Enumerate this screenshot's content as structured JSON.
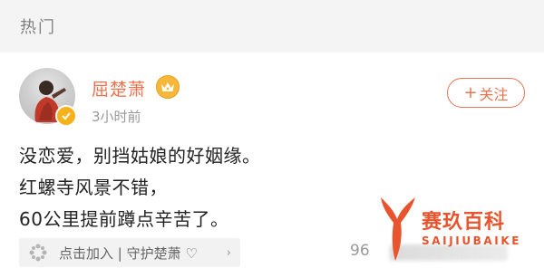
{
  "section": {
    "title": "热门"
  },
  "user": {
    "name": "屈楚萧",
    "time": "3小时前",
    "avatar_icon": "user-avatar",
    "verified_icon": "verified-badge-icon",
    "crown_icon": "crown-icon"
  },
  "follow": {
    "plus": "+",
    "label": "关注"
  },
  "post": {
    "lines": [
      "没恋爱，别挡姑娘的好姻缘。",
      "红螺寺风景不错，",
      "60公里提前蹲点辛苦了。"
    ]
  },
  "fan_club": {
    "label": "点击加入 | 守护楚萧 ♡",
    "icon": "fan-club-icon",
    "chevron": "›"
  },
  "stats": {
    "count_visible": "96"
  },
  "watermark": {
    "name": "赛玖百科",
    "sub": "SAIJIUBAIKE"
  },
  "colors": {
    "accent": "#eb7350",
    "watermark": "#e8542d",
    "section_bg": "#f4f4f4"
  }
}
